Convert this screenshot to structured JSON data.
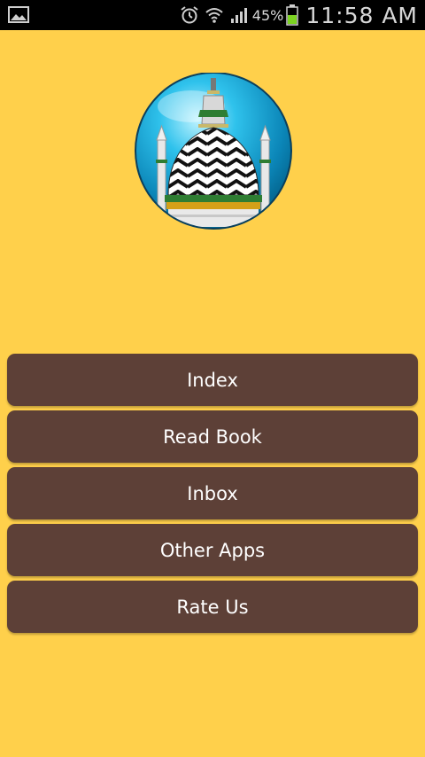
{
  "status_bar": {
    "battery_percent": "45%",
    "time": "11:58 AM",
    "icons": [
      "gallery-icon",
      "alarm-icon",
      "wifi-icon",
      "signal-icon",
      "battery-icon"
    ]
  },
  "colors": {
    "background": "#FFD04B",
    "button": "#5D4037",
    "button_text": "#FFFFFF",
    "status_bar": "#000000"
  },
  "logo": {
    "icon": "mosque-dome-logo"
  },
  "menu": {
    "items": [
      {
        "label": "Index"
      },
      {
        "label": "Read Book"
      },
      {
        "label": "Inbox"
      },
      {
        "label": "Other Apps"
      },
      {
        "label": "Rate Us"
      }
    ]
  }
}
